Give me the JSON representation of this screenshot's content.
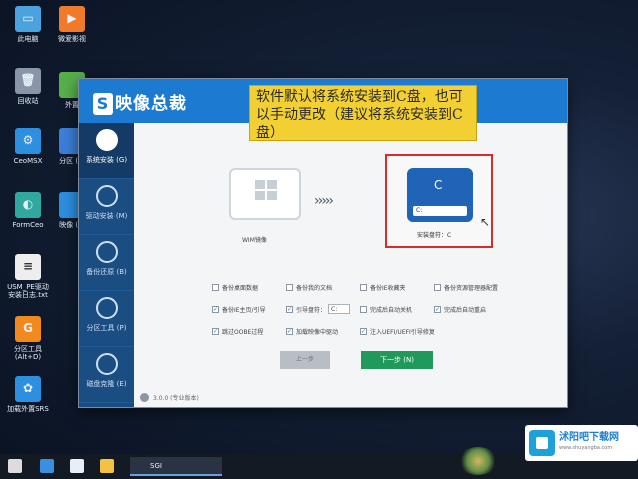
{
  "desktop": {
    "icons": [
      {
        "label": "此电脑",
        "icon": "computer-icon",
        "color": "#4aa3df"
      },
      {
        "label": "微爱影视",
        "icon": "app-icon",
        "color": "#f07a2a"
      },
      {
        "label": "回收站",
        "icon": "recycle-bin-icon",
        "color": "#8a96a8"
      },
      {
        "label": "外置",
        "icon": "app-icon",
        "color": "#56b04a"
      },
      {
        "label": "CeoMSX",
        "icon": "ceomsx-icon",
        "color": "#2d8fe0"
      },
      {
        "label": "分区\n(AI",
        "icon": "partition-icon",
        "color": "#3b7fd9"
      },
      {
        "label": "FormCeo",
        "icon": "formceo-icon",
        "color": "#2fa8a0"
      },
      {
        "label": "映像\n(AI",
        "icon": "image-icon",
        "color": "#2d8fe0"
      },
      {
        "label": "USM_PE驱动安装日志.txt",
        "icon": "text-file-icon",
        "color": "#eeeeee"
      },
      {
        "label": "分区工具\n(Alt+D)",
        "icon": "partition-tool-icon",
        "color": "#f08a1c"
      },
      {
        "label": "加载外置SRS",
        "icon": "srs-icon",
        "color": "#2d8fe0"
      }
    ]
  },
  "window": {
    "brand": "映像总裁",
    "tooltip": "软件默认将系统安装到C盘，也可以手动更改（建议将系统安装到C盘）",
    "sidebar": [
      {
        "label": "系统安装 (G)"
      },
      {
        "label": "驱动安装 (M)"
      },
      {
        "label": "备份还原 (B)"
      },
      {
        "label": "分区工具 (P)"
      },
      {
        "label": "磁盘克隆 (E)"
      }
    ],
    "source_label": "WIM镜像",
    "arrows": "›››››",
    "target_drive_letter": "C",
    "target_bar_text": "C:",
    "target_label": "安装盘符：C",
    "options_row1": [
      "备份桌面数据",
      "备份我的文档",
      "备份IE收藏夹",
      "备份资源管理器配置"
    ],
    "options_row2": [
      "备份IE主页/引导",
      "引导盘符：",
      "C:",
      "完成后自动关机",
      "完成后自动重启"
    ],
    "options_row3": [
      "跳过OOBE过程",
      "加载映像中驱动",
      "注入UEFI/UEFI引导修复"
    ],
    "prev_button": "上一步",
    "next_button": "下一步 (N)",
    "version": "3.0.0  (专业版本)"
  },
  "taskbar": {
    "app_label": "SGI",
    "tray_text": "  ",
    "watermark": "沭阳吧下载网",
    "watermark_sub": "www.shuyangba.com"
  }
}
